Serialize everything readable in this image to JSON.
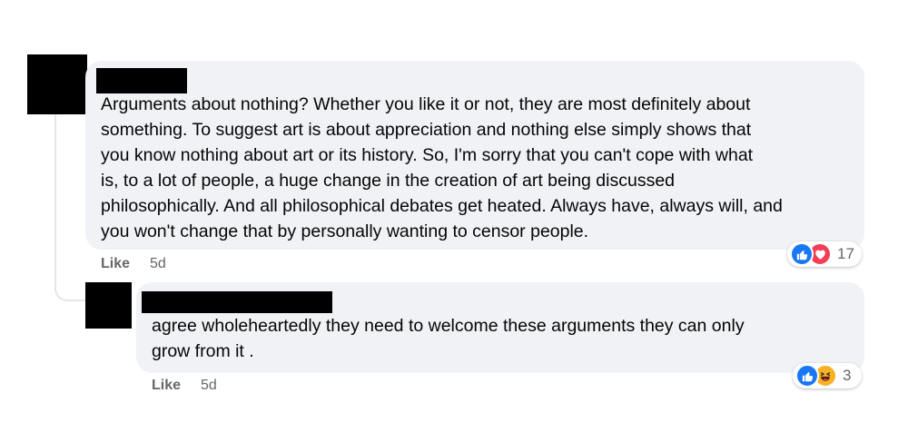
{
  "comment": {
    "author": "",
    "text": "Arguments about nothing? Whether you like it or not, they are most definitely about\nsomething. To suggest art is about appreciation and nothing else simply shows that\nyou know nothing about art or its history. So, I'm sorry that you can't cope with what\nis, to a lot of people, a huge change in the creation of art being discussed\nphilosophically. And all philosophical debates get heated. Always have, always will, and\nyou won't change that by personally wanting to censor people.",
    "reactions": {
      "icons": [
        "like-icon",
        "love-icon"
      ],
      "count": "17"
    },
    "like_label": "Like",
    "time": "5d"
  },
  "reply": {
    "author": "",
    "text": "agree wholeheartedly they need to welcome these arguments they can only\ngrow from it .",
    "reactions": {
      "icons": [
        "like-icon",
        "haha-icon"
      ],
      "count": "3"
    },
    "like_label": "Like",
    "time": "5d"
  },
  "colors": {
    "bubble": "#f0f2f5",
    "like": "#1877f2",
    "love": "#f33e58",
    "haha": "#f7b125",
    "meta_text": "#65676b"
  }
}
